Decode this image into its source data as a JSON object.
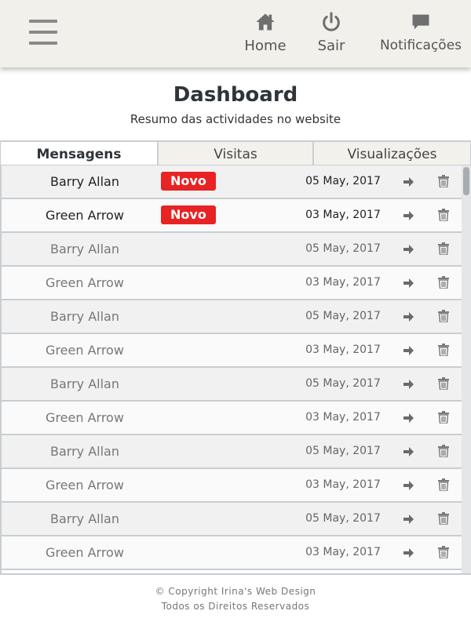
{
  "header": {
    "menu_icon": "hamburger-menu-icon",
    "nav": [
      {
        "label": "Home",
        "icon": "home-icon"
      },
      {
        "label": "Sair",
        "icon": "power-icon"
      },
      {
        "label": "Notificações",
        "icon": "chat-bubble-icon"
      }
    ]
  },
  "page": {
    "title": "Dashboard",
    "subtitle": "Resumo das actividades no website"
  },
  "tabs": [
    {
      "label": "Mensagens",
      "active": true
    },
    {
      "label": "Visitas",
      "active": false
    },
    {
      "label": "Visualizações",
      "active": false
    }
  ],
  "messages": [
    {
      "name": "Barry Allan",
      "badge": "Novo",
      "date": "05 May, 2017"
    },
    {
      "name": "Green Arrow",
      "badge": "Novo",
      "date": "03 May, 2017"
    },
    {
      "name": "Barry Allan",
      "badge": "",
      "date": "05 May, 2017"
    },
    {
      "name": "Green Arrow",
      "badge": "",
      "date": "03 May, 2017"
    },
    {
      "name": "Barry Allan",
      "badge": "",
      "date": "05 May, 2017"
    },
    {
      "name": "Green Arrow",
      "badge": "",
      "date": "03 May, 2017"
    },
    {
      "name": "Barry Allan",
      "badge": "",
      "date": "05 May, 2017"
    },
    {
      "name": "Green Arrow",
      "badge": "",
      "date": "03 May, 2017"
    },
    {
      "name": "Barry Allan",
      "badge": "",
      "date": "05 May, 2017"
    },
    {
      "name": "Green Arrow",
      "badge": "",
      "date": "03 May, 2017"
    },
    {
      "name": "Barry Allan",
      "badge": "",
      "date": "05 May, 2017"
    },
    {
      "name": "Green Arrow",
      "badge": "",
      "date": "03 May, 2017"
    }
  ],
  "row_icons": {
    "open": "arrow-right-icon",
    "delete": "trash-icon"
  },
  "footer": {
    "line1": "© Copyright Irina's Web Design",
    "line2": "Todos os Direitos Reservados"
  },
  "colors": {
    "badge": "#e82323",
    "header_bg": "#f2f0eb"
  }
}
